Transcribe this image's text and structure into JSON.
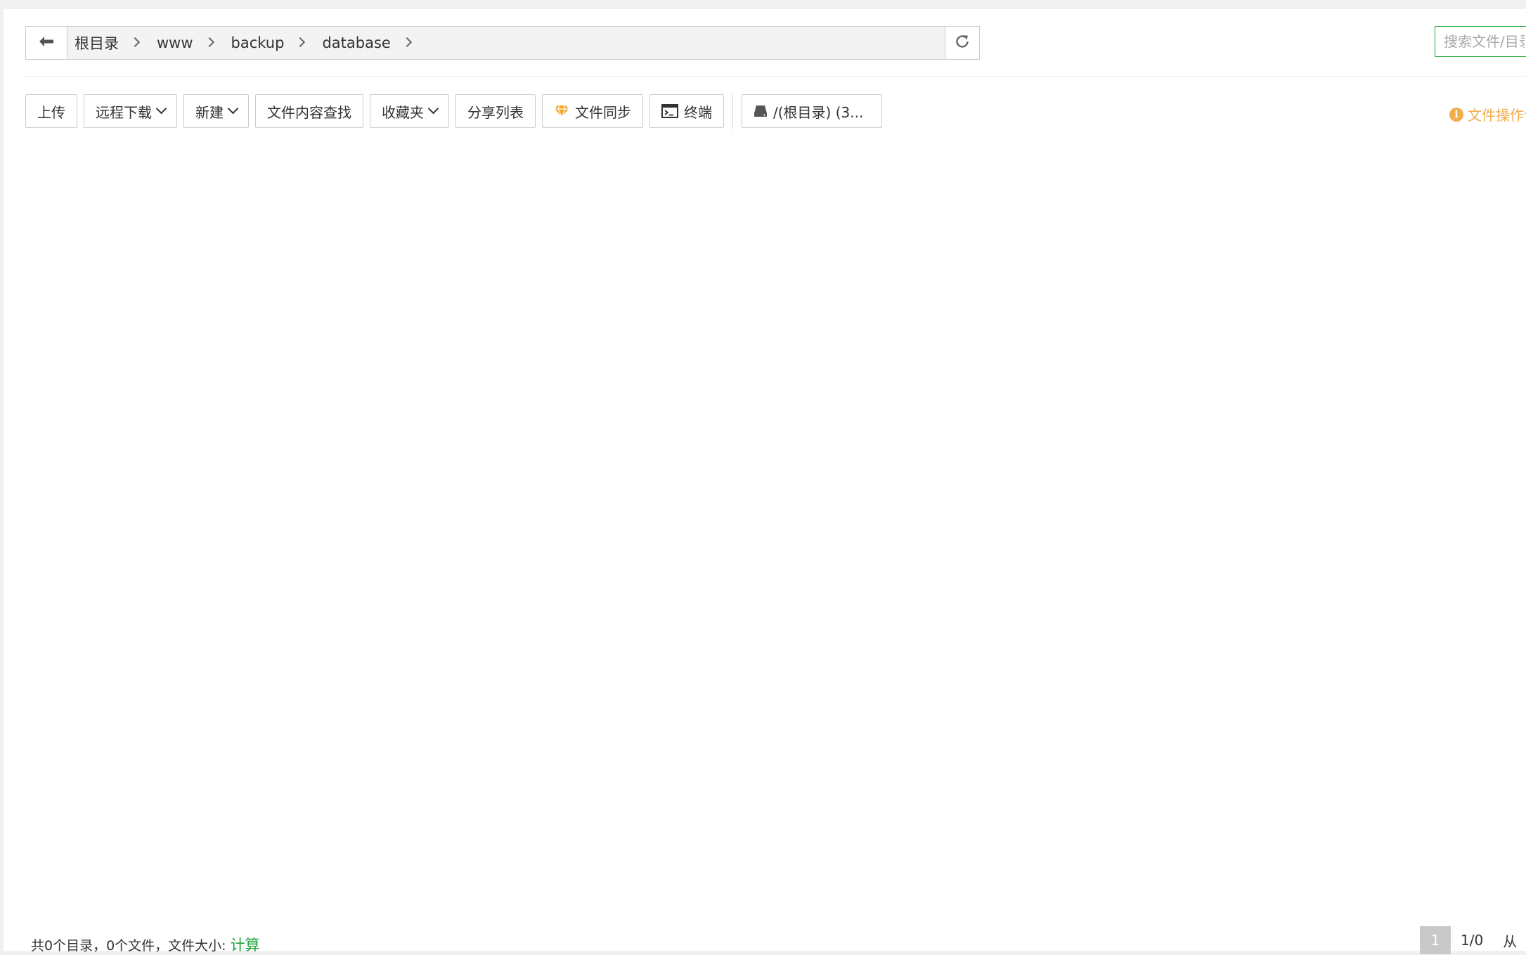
{
  "breadcrumb": {
    "items": [
      {
        "label": "根目录"
      },
      {
        "label": "www"
      },
      {
        "label": "backup"
      },
      {
        "label": "database"
      }
    ]
  },
  "search": {
    "placeholder": "搜索文件/目录"
  },
  "toolbar": {
    "upload": "上传",
    "remote_download": "远程下载",
    "new": "新建",
    "content_search": "文件内容查找",
    "favorites": "收藏夹",
    "share_list": "分享列表",
    "file_sync": "文件同步",
    "terminal": "终端",
    "disk": "/(根目录) (3..."
  },
  "tip": {
    "text": "文件操作记录"
  },
  "footer": {
    "summary": "共0个目录，0个文件，文件大小: ",
    "calc_link": "计算"
  },
  "pagination": {
    "current": "1",
    "info": "1/0",
    "from_label": "从"
  },
  "colors": {
    "accent_green": "#20a53a",
    "warning_orange": "#f0ad4e"
  }
}
